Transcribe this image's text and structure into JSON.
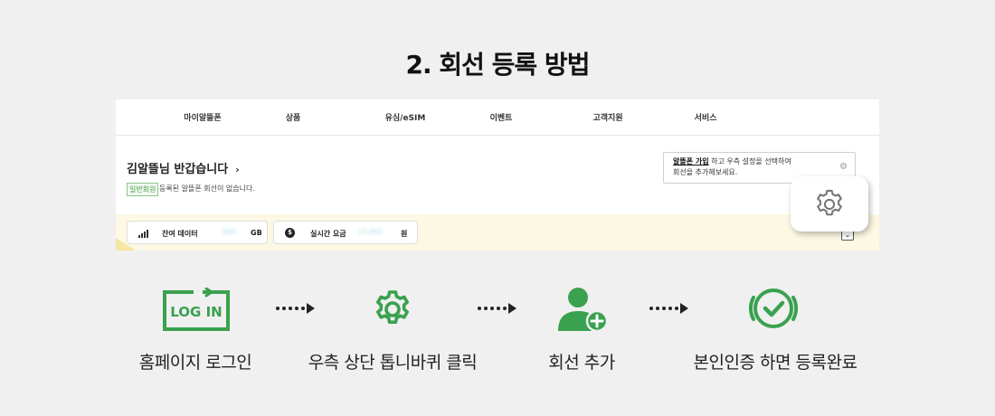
{
  "title": "2. 회선 등록 방법",
  "site": {
    "nav": [
      "마이알뜰폰",
      "상품",
      "유심/eSIM",
      "이벤트",
      "고객지원",
      "서비스"
    ],
    "greeting": "김알뜰님 반갑습니다",
    "greeting_chevron": "›",
    "member_badge": "일반회원",
    "member_note": "등록된 알뜰폰 회선이 없습니다.",
    "tip_link": "알뜰폰 가입",
    "tip_text1": " 하고 우측 설정을 선택하여",
    "tip_text2": "회선을 추가해보세요.",
    "data_label": "잔여 데이터",
    "data_value": "999",
    "data_unit": "GB",
    "fee_label": "실시간 요금",
    "fee_value": "23,900",
    "fee_unit": "원",
    "won_symbol": "$",
    "collapse_symbol": "⌄"
  },
  "steps": [
    {
      "label": "홈페이지 로그인",
      "icon": "login-icon",
      "icon_text": "LOG IN"
    },
    {
      "label": "우측 상단 톱니바퀴 클릭",
      "icon": "gear-icon"
    },
    {
      "label": "회선 추가",
      "icon": "add-user-icon"
    },
    {
      "label": "본인인증 하면 등록완료",
      "icon": "verified-check-icon"
    }
  ],
  "colors": {
    "accent_green": "#3aa14f",
    "band_yellow": "#fdf8e3",
    "background": "#f0f0f0"
  }
}
